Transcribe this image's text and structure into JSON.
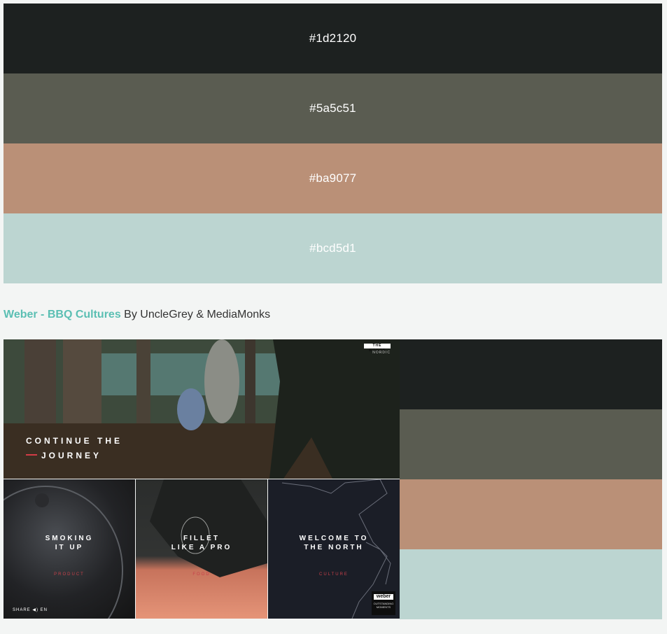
{
  "swatches": [
    {
      "hex": "#1d2120",
      "color": "#1d2120"
    },
    {
      "hex": "#5a5c51",
      "color": "#5a5c51"
    },
    {
      "hex": "#ba9077",
      "color": "#ba9077"
    },
    {
      "hex": "#bcd5d1",
      "color": "#bcd5d1"
    }
  ],
  "caption": {
    "title": "Weber - BBQ Cultures",
    "byline": " By UncleGrey & MediaMonks"
  },
  "screenshot": {
    "hero": {
      "badge_line1": "THE WOODS",
      "badge_line2": "NORDIC",
      "line1": "CONTINUE THE",
      "line2": "JOURNEY"
    },
    "tiles": [
      {
        "line1": "SMOKING",
        "line2": "IT UP",
        "sub": "PRODUCT",
        "footer": "SHARE ◀) EN"
      },
      {
        "line1": "FILLET",
        "line2": "LIKE A PRO",
        "sub": "FOOD"
      },
      {
        "line1": "WELCOME TO",
        "line2": "THE NORTH",
        "sub": "CULTURE",
        "logo": "weber",
        "logo_sub": "OUTSTANDING MOMENTS"
      }
    ]
  }
}
